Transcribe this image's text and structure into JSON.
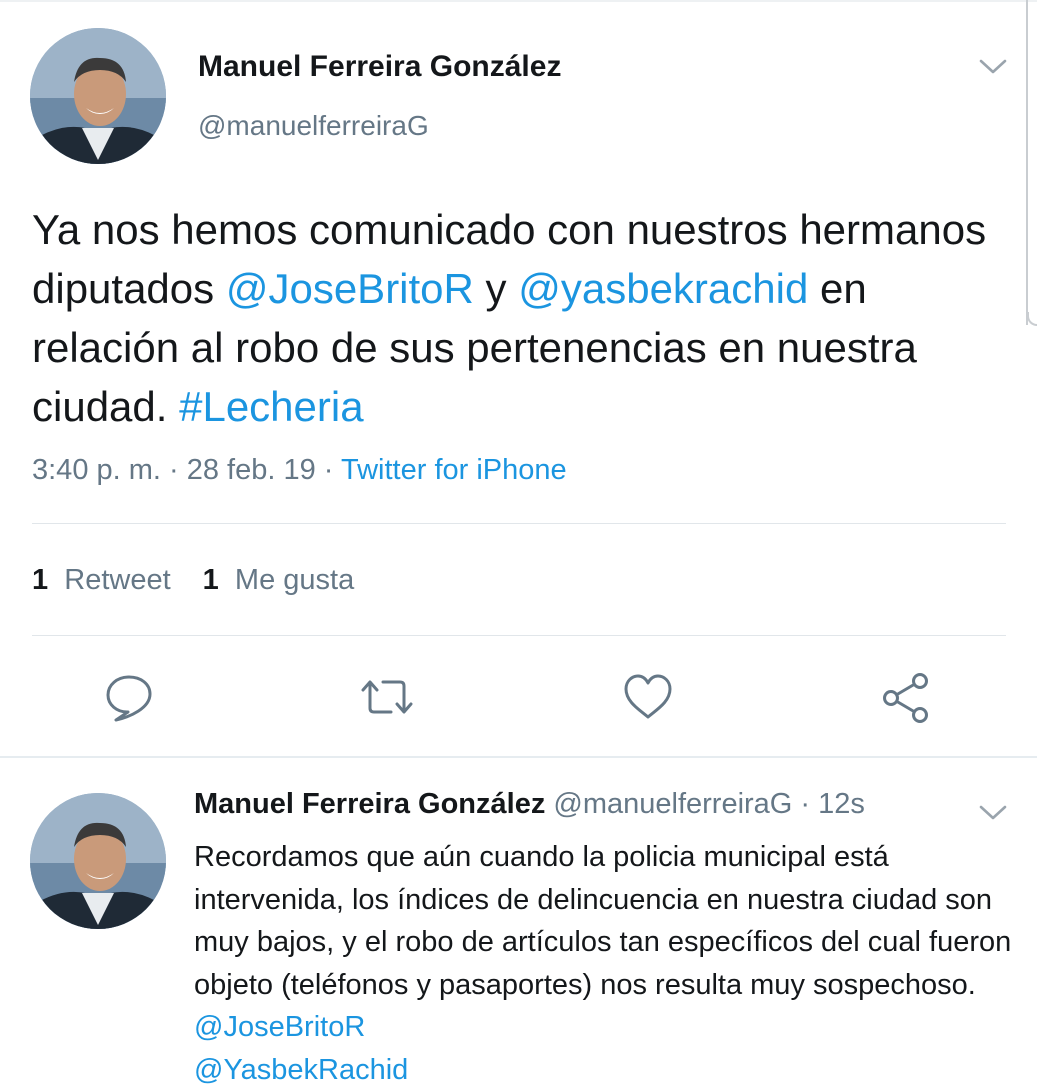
{
  "tweet": {
    "author_name": "Manuel Ferreira González",
    "author_handle": "@manuelferreiraG",
    "text_parts": {
      "p1": "Ya nos hemos comunicado con nuestros hermanos diputados ",
      "mention1": "@JoseBritoR",
      "p2": " y ",
      "mention2": "@yasbekrachid",
      "p3": " en relación al robo de sus pertenencias en nuestra ciudad. ",
      "hashtag": "#Lecheria"
    },
    "timestamp": "3:40 p. m. · 28 feb. 19 · ",
    "source": "Twitter for iPhone",
    "retweet_count": "1",
    "retweet_label": "Retweet",
    "like_count": "1",
    "like_label": "Me gusta"
  },
  "reply": {
    "author_name": "Manuel Ferreira González",
    "author_handle": "@manuelferreiraG",
    "time": " · 12s",
    "text_parts": {
      "p1": "Recordamos que aún cuando la policia municipal está intervenida, los índices de delincuencia en nuestra ciudad son muy bajos, y el robo de artículos tan específicos del cual fueron objeto (teléfonos y pasaportes) nos resulta muy sospechoso. ",
      "mention1": "@JoseBritoR",
      "p2": " ",
      "mention2": "@YasbekRachid"
    }
  },
  "icons": {
    "reply": "reply-icon",
    "retweet": "retweet-icon",
    "like": "heart-icon",
    "share": "share-icon",
    "caret": "chevron-down-icon"
  },
  "colors": {
    "link": "#1b95e0",
    "secondary_text": "#657786",
    "primary_text": "#14171a",
    "icon": "#657786"
  }
}
